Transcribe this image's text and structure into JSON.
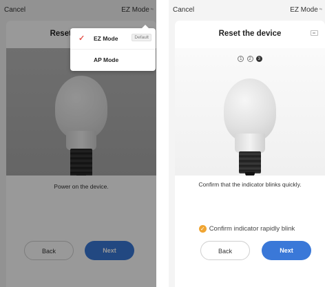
{
  "left_screen": {
    "topbar": {
      "cancel_label": "Cancel",
      "mode_label": "EZ Mode",
      "mode_arrow": "⇆"
    },
    "card": {
      "title": "Reset the device"
    },
    "instruction": "Power on the device.",
    "buttons": {
      "back_label": "Back",
      "next_label": "Next"
    },
    "dropdown": {
      "items": [
        {
          "label": "EZ Mode",
          "badge": "Default",
          "selected": true,
          "check": "✓"
        },
        {
          "label": "AP Mode",
          "selected": false
        }
      ]
    }
  },
  "right_screen": {
    "topbar": {
      "cancel_label": "Cancel",
      "mode_label": "EZ Mode",
      "mode_arrow": "⇆"
    },
    "card": {
      "title": "Reset the device"
    },
    "steps": [
      "1",
      "2",
      "3"
    ],
    "active_step": 3,
    "instruction": "Confirm that the indicator blinks quickly.",
    "confirm": {
      "label": "Confirm indicator rapidly blink",
      "checked": true,
      "check": "✓"
    },
    "buttons": {
      "back_label": "Back",
      "next_label": "Next"
    }
  },
  "colors": {
    "accent_blue": "#3a78d8",
    "confirm_orange": "#f0a532",
    "check_red": "#e5534b"
  },
  "icons": {
    "camera": "camera-icon",
    "check": "checkmark-icon",
    "mode_switch": "switch-arrows-icon"
  }
}
